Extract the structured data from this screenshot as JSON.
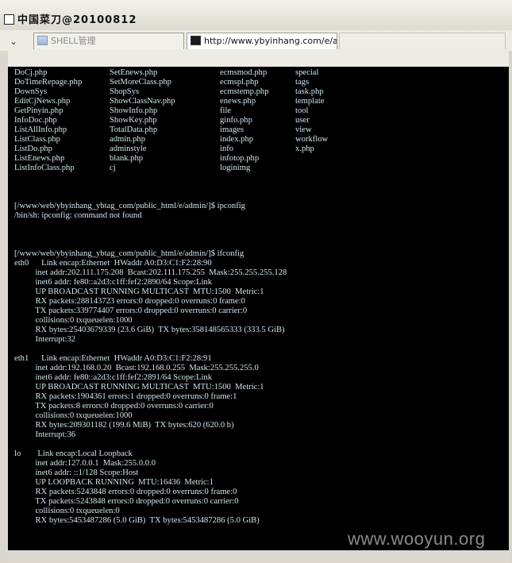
{
  "window": {
    "title": "中国菜刀@20100812"
  },
  "tabs": [
    {
      "label": "SHELL管理",
      "icon": "shell-manager-icon",
      "active": false
    },
    {
      "label": "http://www.ybyinhang.com/e/a...",
      "icon": "terminal-icon",
      "active": true
    }
  ],
  "terminal": {
    "file_listing": [
      [
        "DoCj.php",
        "SetEnews.php",
        "ecmsmod.php",
        "special"
      ],
      [
        "DoTimeRepage.php",
        "SetMoreClass.php",
        "ecmspl.php",
        "tags"
      ],
      [
        "DownSys",
        "ShopSys",
        "ecmstemp.php",
        "task.php"
      ],
      [
        "EditCjNews.php",
        "ShowClassNav.php",
        "enews.php",
        "template"
      ],
      [
        "GetPinyin.php",
        "ShowInfo.php",
        "file",
        "tool"
      ],
      [
        "InfoDoc.php",
        "ShowKey.php",
        "ginfo.php",
        "user"
      ],
      [
        "ListAllInfo.php",
        "TotalData.php",
        "images",
        "view"
      ],
      [
        "ListClass.php",
        "admin.php",
        "index.php",
        "workflow"
      ],
      [
        "ListDo.php",
        "adminstyle",
        "info",
        "x.php"
      ],
      [
        "ListEnews.php",
        "blank.php",
        "infotop.php",
        ""
      ],
      [
        "ListInfoClass.php",
        "cj",
        "loginimg",
        ""
      ]
    ],
    "lines": [
      "",
      "",
      "",
      "[/www/web/ybyinhang_ybtag_com/public_html/e/admin/]$ ipconfig",
      "/bin/sh: ipconfig: command not found",
      "",
      "",
      "",
      "[/www/web/ybyinhang_ybtag_com/public_html/e/admin/]$ ifconfig",
      "eth0      Link encap:Ethernet  HWaddr A0:D3:C1:F2:28:90",
      "          inet addr:202.111.175.208  Bcast:202.111.175.255  Mask:255.255.255.128",
      "          inet6 addr: fe80::a2d3:c1ff:fef2:2890/64 Scope:Link",
      "          UP BROADCAST RUNNING MULTICAST  MTU:1500  Metric:1",
      "          RX packets:288143723 errors:0 dropped:0 overruns:0 frame:0",
      "          TX packets:339774407 errors:0 dropped:0 overruns:0 carrier:0",
      "          collisions:0 txqueuelen:1000",
      "          RX bytes:25403679339 (23.6 GiB)  TX bytes:358148565333 (333.5 GiB)",
      "          Interrupt:32",
      "",
      "eth1      Link encap:Ethernet  HWaddr A0:D3:C1:F2:28:91",
      "          inet addr:192.168.0.20  Bcast:192.168.0.255  Mask:255.255.255.0",
      "          inet6 addr: fe80::a2d3:c1ff:fef2:2891/64 Scope:Link",
      "          UP BROADCAST RUNNING MULTICAST  MTU:1500  Metric:1",
      "          RX packets:1904361 errors:1 dropped:0 overruns:0 frame:1",
      "          TX packets:8 errors:0 dropped:0 overruns:0 carrier:0",
      "          collisions:0 txqueuelen:1000",
      "          RX bytes:209301182 (199.6 MiB)  TX bytes:620 (620.0 b)",
      "          Interrupt:36",
      "",
      "lo        Link encap:Local Loopback",
      "          inet addr:127.0.0.1  Mask:255.0.0.0",
      "          inet6 addr: ::1/128 Scope:Host",
      "          UP LOOPBACK RUNNING  MTU:16436  Metric:1",
      "          RX packets:5243848 errors:0 dropped:0 overruns:0 frame:0",
      "          TX packets:5243848 errors:0 dropped:0 overruns:0 carrier:0",
      "          collisions:0 txqueuelen:0",
      "          RX bytes:5453487286 (5.0 GiB)  TX bytes:5453487286 (5.0 GiB)",
      "",
      "",
      "",
      "",
      "[/www/web/ybyinhang_ybtag_com/public_html/e/admin/]$"
    ]
  },
  "watermark": "www.wooyun.org",
  "colors": {
    "terminal_bg": "#000000",
    "terminal_text": "#cfe6ef",
    "chrome": "#ece9d8"
  }
}
